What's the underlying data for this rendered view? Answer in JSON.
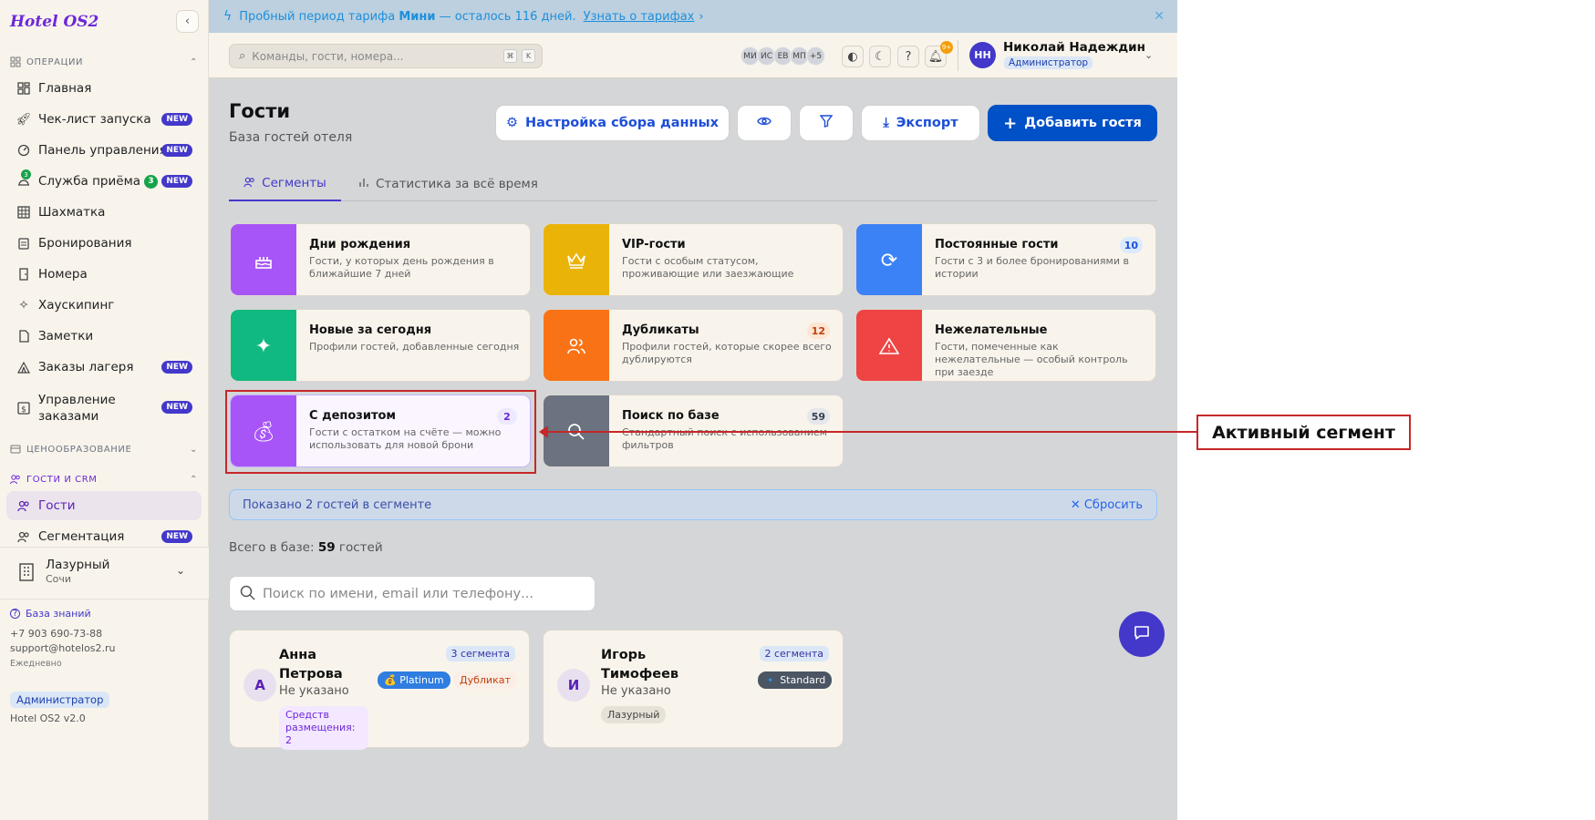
{
  "sidebar": {
    "logo": "Hotel OS2",
    "sections": {
      "operations": "ОПЕРАЦИИ",
      "pricing": "ЦЕНООБРАЗОВАНИЕ",
      "guests_crm": "ГОСТИ И CRM"
    },
    "items": [
      {
        "label": "Главная",
        "icon": "dashboard-icon"
      },
      {
        "label": "Чек-лист запуска",
        "icon": "rocket-icon",
        "badge": "NEW"
      },
      {
        "label": "Панель управления",
        "icon": "gauge-icon",
        "badge": "NEW"
      },
      {
        "label": "Служба приёма",
        "icon": "reception-icon",
        "badge": "NEW",
        "count": "3",
        "icon_count": "3"
      },
      {
        "label": "Шахматка",
        "icon": "grid-icon"
      },
      {
        "label": "Бронирования",
        "icon": "clipboard-icon"
      },
      {
        "label": "Номера",
        "icon": "door-icon"
      },
      {
        "label": "Хаускипинг",
        "icon": "sparkle-icon"
      },
      {
        "label": "Заметки",
        "icon": "note-icon"
      },
      {
        "label": "Заказы лагеря",
        "icon": "tent-icon",
        "badge": "NEW"
      },
      {
        "label": "Управление заказами",
        "icon": "dollar-icon",
        "badge": "NEW"
      }
    ],
    "crm_items": [
      {
        "label": "Гости",
        "icon": "users-icon"
      },
      {
        "label": "Сегментация",
        "icon": "users-icon",
        "badge": "NEW"
      }
    ],
    "hotel": {
      "name": "Лазурный",
      "city": "Сочи"
    },
    "footer": {
      "kb": "База знаний",
      "phone": "+7 903 690-73-88",
      "email": "support@hotelos2.ru",
      "daily": "Ежедневно",
      "role": "Администратор",
      "version": "Hotel OS2 v2.0"
    }
  },
  "banner": {
    "prefix": "Пробный период тарифа",
    "plan": "Мини",
    "suffix": "— осталось 116 дней.",
    "link": "Узнать о тарифах"
  },
  "topbar": {
    "search_placeholder": "Команды, гости, номера...",
    "kbd1": "⌘",
    "kbd2": "K",
    "avatars": [
      "МИ",
      "ИС",
      "ЕВ",
      "МП",
      "+5"
    ],
    "notif_count": "9+",
    "user": {
      "initials": "НН",
      "name": "Николай Надеждин",
      "role": "Администратор"
    }
  },
  "page": {
    "title": "Гости",
    "subtitle": "База гостей отеля",
    "buttons": {
      "settings": "Настройка сбора данных",
      "export": "Экспорт",
      "add": "Добавить гостя"
    },
    "tabs": [
      "Сегменты",
      "Статистика за всё время"
    ]
  },
  "segments": [
    {
      "title": "Дни рождения",
      "desc": "Гости, у которых день рождения в ближайшие 7 дней",
      "color": "#a855f7",
      "icon": "cake-icon",
      "count": ""
    },
    {
      "title": "VIP-гости",
      "desc": "Гости с особым статусом, проживающие или заезжающие",
      "color": "#eab308",
      "icon": "crown-icon",
      "count": ""
    },
    {
      "title": "Постоянные гости",
      "desc": "Гости с 3 и более бронированиями в истории",
      "color": "#3b82f6",
      "icon": "refresh-icon",
      "count": "10"
    },
    {
      "title": "Новые за сегодня",
      "desc": "Профили гостей, добавленные сегодня",
      "color": "#10b981",
      "icon": "sparkles-icon",
      "count": ""
    },
    {
      "title": "Дубликаты",
      "desc": "Профили гостей, которые скорее всего дублируются",
      "color": "#f97316",
      "icon": "users-icon",
      "count": "12"
    },
    {
      "title": "Нежелательные",
      "desc": "Гости, помеченные как нежелательные — особый контроль при заезде",
      "color": "#ef4444",
      "icon": "warning-icon",
      "count": ""
    },
    {
      "title": "С депозитом",
      "desc": "Гости с остатком на счёте — можно использовать для новой брони",
      "color": "#a855f7",
      "icon": "money-bag-icon",
      "count": "2"
    },
    {
      "title": "Поиск по базе",
      "desc": "Стандартный поиск с использованием фильтров",
      "color": "#6b7280",
      "icon": "search-icon",
      "count": "59"
    }
  ],
  "info_bar": {
    "text": "Показано 2 гостей в сегменте",
    "reset": "Сбросить"
  },
  "total": {
    "label": "Всего в базе:",
    "value": "59",
    "unit": "гостей"
  },
  "guest_search_placeholder": "Поиск по имени, email или телефону...",
  "guests": [
    {
      "initial": "А",
      "name": "Анна Петрова",
      "sub": "Не указано",
      "segments": "3 сегмента",
      "tag1": "💰 Platinum",
      "tag2": "Дубликат",
      "tag3": "Средств размещения: 2"
    },
    {
      "initial": "И",
      "name": "Игорь Тимофеев",
      "sub": "Не указано",
      "segments": "2 сегмента",
      "tag1": "🔹 Standard",
      "tag3": "Лазурный"
    }
  ],
  "annotation": {
    "callout": "Активный сегмент"
  }
}
